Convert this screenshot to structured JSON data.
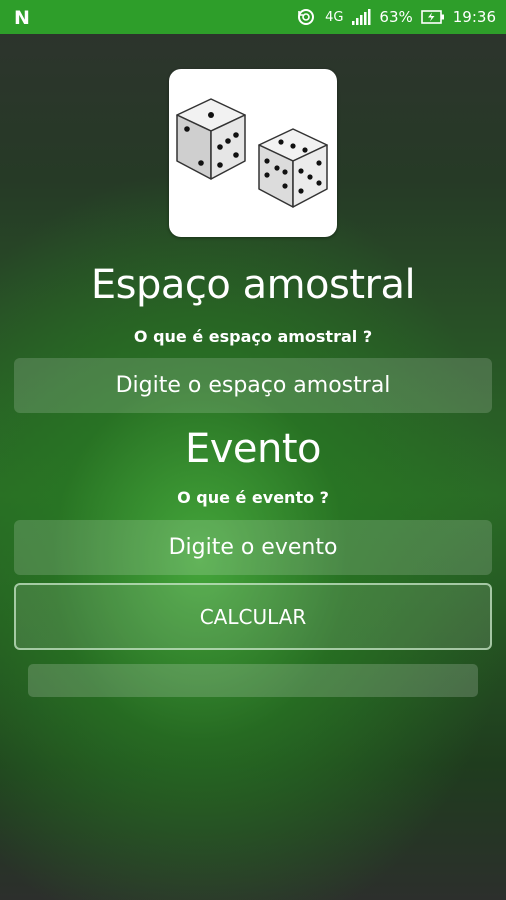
{
  "status_bar": {
    "app_logo": "N",
    "network": "4G",
    "battery_percent": "63%",
    "time": "19:36",
    "icons": [
      "sync-icon",
      "network-4g-icon",
      "signal-icon",
      "battery-charging-icon"
    ]
  },
  "app": {
    "logo_icon": "dice-icon",
    "sample_space": {
      "title": "Espaço amostral",
      "question": "O que é espaço amostral ?",
      "input_placeholder": "Digite o espaço amostral"
    },
    "event": {
      "title": "Evento",
      "question": "O que é evento ?",
      "input_placeholder": "Digite o evento"
    },
    "calculate_button": "CALCULAR",
    "result": ""
  },
  "colors": {
    "status_bar": "#2e9e2a",
    "background_green": "#3a9a34",
    "text": "#ffffff"
  }
}
